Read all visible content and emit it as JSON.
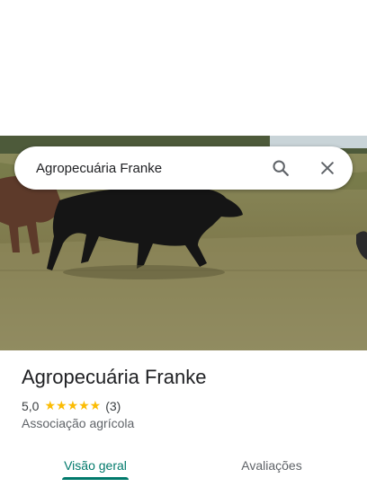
{
  "search": {
    "query": "Agropecuária Franke"
  },
  "place": {
    "name": "Agropecuária Franke",
    "rating": "5,0",
    "stars": "★★★★★",
    "review_count": "(3)",
    "category": "Associação agrícola"
  },
  "tabs": [
    {
      "label": "Visão geral",
      "selected": true
    },
    {
      "label": "Avaliações",
      "selected": false
    }
  ],
  "colors": {
    "accent": "#00796b",
    "star": "#fbbc04"
  },
  "icons": {
    "search": "search-icon",
    "close": "close-icon"
  }
}
